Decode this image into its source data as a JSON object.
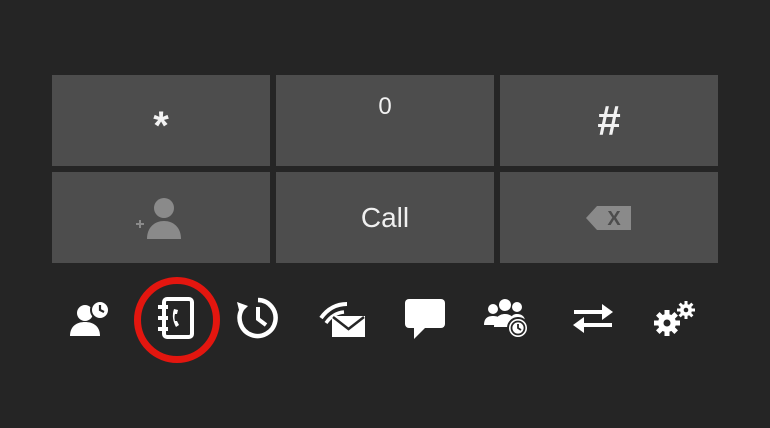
{
  "keypad": {
    "star_label": "*",
    "zero_label": "0",
    "hash_label": "#",
    "call_label": "Call",
    "add_contact_icon": "add-contact-icon",
    "backspace_icon": "backspace-icon"
  },
  "toolbar": {
    "items": [
      {
        "icon": "contact-status-icon"
      },
      {
        "icon": "phonebook-icon",
        "highlighted": true
      },
      {
        "icon": "call-history-icon"
      },
      {
        "icon": "voicemail-icon"
      },
      {
        "icon": "chat-icon"
      },
      {
        "icon": "group-presence-icon"
      },
      {
        "icon": "transfer-icon"
      },
      {
        "icon": "settings-icon"
      }
    ]
  },
  "colors": {
    "background": "#252525",
    "key": "#4d4d4d",
    "key_text": "#f2f2f2",
    "disabled_icon": "#8a8a8a",
    "icon": "#ffffff",
    "highlight": "#e3160f"
  }
}
